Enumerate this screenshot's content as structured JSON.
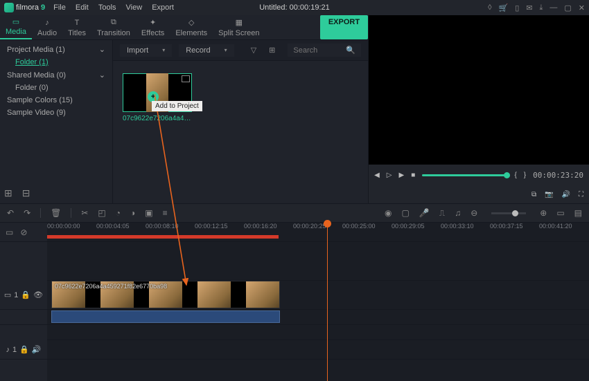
{
  "app": {
    "name": "filmora",
    "version": "9",
    "title": "Untitled:  00:00:19:21"
  },
  "menu": [
    "File",
    "Edit",
    "Tools",
    "View",
    "Export"
  ],
  "tabs": [
    {
      "label": "Media",
      "icon": "folder"
    },
    {
      "label": "Audio",
      "icon": "music"
    },
    {
      "label": "Titles",
      "icon": "text"
    },
    {
      "label": "Transition",
      "icon": "transition"
    },
    {
      "label": "Effects",
      "icon": "effects"
    },
    {
      "label": "Elements",
      "icon": "elements"
    },
    {
      "label": "Split Screen",
      "icon": "split"
    }
  ],
  "export_label": "EXPORT",
  "tree": [
    {
      "label": "Project Media (1)",
      "expandable": true
    },
    {
      "label": "Folder (1)",
      "child": true,
      "selected": true
    },
    {
      "label": "Shared Media (0)",
      "expandable": true
    },
    {
      "label": "Folder (0)",
      "child": true
    },
    {
      "label": "Sample Colors (15)"
    },
    {
      "label": "Sample Video (9)"
    }
  ],
  "media_bar": {
    "import": "Import",
    "record": "Record",
    "search_placeholder": "Search"
  },
  "clip_thumb": {
    "name": "07c9622e7206a4a4592...",
    "tooltip": "Add to Project"
  },
  "preview": {
    "time": "00:00:23:20"
  },
  "timeline": {
    "marks": [
      "00:00:00:00",
      "00:00:04:05",
      "00:00:08:10",
      "00:00:12:15",
      "00:00:16:20",
      "00:00:20:25",
      "00:00:25:00",
      "00:00:29:05",
      "00:00:33:10",
      "00:00:37:15",
      "00:00:41:20"
    ],
    "clip_name": "07c9622e7206a4a459271f82e6770ba98",
    "video_track": "1",
    "audio_track": "1",
    "music_track": "1"
  }
}
